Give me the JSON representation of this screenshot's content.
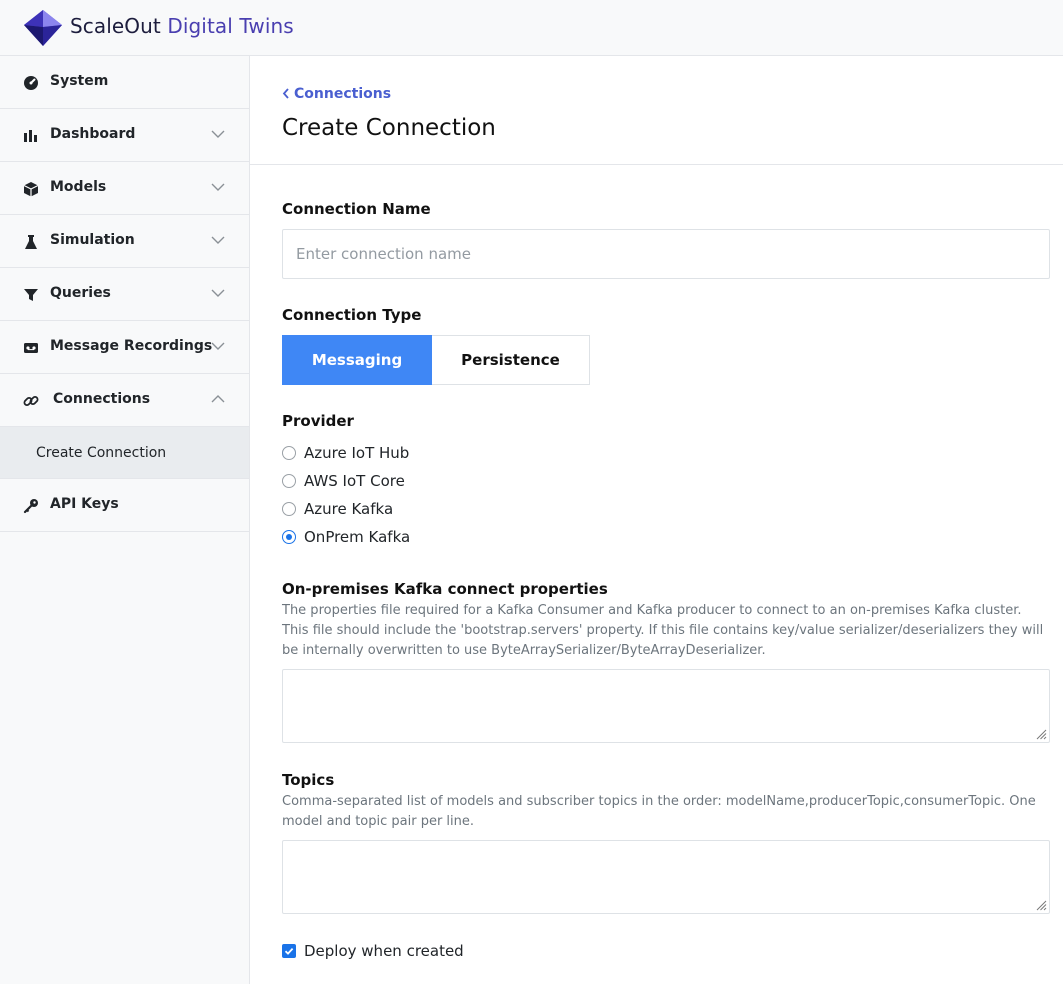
{
  "app": {
    "brand_part1": "ScaleOut",
    "brand_part2": "Digital Twins",
    "brand_color": "#4a3fb0",
    "logo_icon": "diamond-logo-icon"
  },
  "sidebar": {
    "items": [
      {
        "label": "System",
        "icon": "gauge-icon",
        "has_chevron": false
      },
      {
        "label": "Dashboard",
        "icon": "bar-chart-icon",
        "has_chevron": true,
        "expanded": false
      },
      {
        "label": "Models",
        "icon": "cube-icon",
        "has_chevron": true,
        "expanded": false
      },
      {
        "label": "Simulation",
        "icon": "flask-icon",
        "has_chevron": true,
        "expanded": false
      },
      {
        "label": "Queries",
        "icon": "filter-icon",
        "has_chevron": true,
        "expanded": false
      },
      {
        "label": "Message Recordings",
        "icon": "recorder-icon",
        "has_chevron": true,
        "expanded": false
      },
      {
        "label": "Connections",
        "icon": "link-icon",
        "has_chevron": true,
        "expanded": true
      },
      {
        "label": "API Keys",
        "icon": "key-icon",
        "has_chevron": false
      }
    ],
    "subitem": {
      "label": "Create Connection",
      "selected": true
    }
  },
  "page": {
    "breadcrumb": "Connections",
    "title": "Create Connection"
  },
  "form": {
    "name_label": "Connection Name",
    "name_placeholder": "Enter connection name",
    "name_value": "",
    "type_label": "Connection Type",
    "type_options": [
      "Messaging",
      "Persistence"
    ],
    "type_selected": "Messaging",
    "provider_label": "Provider",
    "providers": [
      {
        "label": "Azure IoT Hub",
        "checked": false
      },
      {
        "label": "AWS IoT Core",
        "checked": false
      },
      {
        "label": "Azure Kafka",
        "checked": false
      },
      {
        "label": "OnPrem Kafka",
        "checked": true
      }
    ],
    "kafka_props_label": "On-premises Kafka connect properties",
    "kafka_props_help": "The properties file required for a Kafka Consumer and Kafka producer to connect to an on-premises Kafka cluster. This file should include the 'bootstrap.servers' property. If this file contains key/value serializer/deserializers they will be internally overwritten to use ByteArraySerializer/ByteArrayDeserializer.",
    "kafka_props_value": "",
    "topics_label": "Topics",
    "topics_help": "Comma-separated list of models and subscriber topics in the order: modelName,producerTopic,consumerTopic. One model and topic pair per line.",
    "topics_value": "",
    "deploy_label": "Deploy when created",
    "deploy_checked": true
  },
  "colors": {
    "accent": "#3f87f5",
    "link": "#4a5fd0",
    "radio_checked": "#1a73e8",
    "sidebar_bg": "#f8f9fa",
    "selected_bg": "#e9ecef"
  }
}
